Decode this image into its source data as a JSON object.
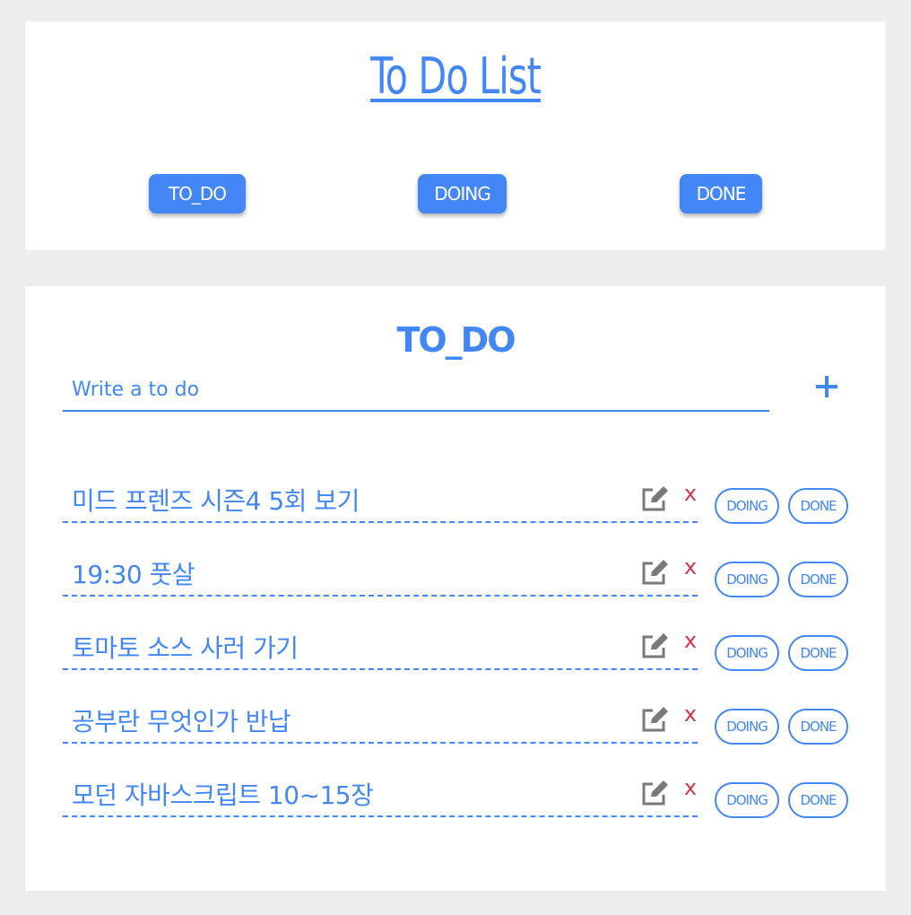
{
  "header": {
    "title": "To Do List",
    "nav": [
      {
        "label": "TO_DO"
      },
      {
        "label": "DOING"
      },
      {
        "label": "DONE"
      }
    ]
  },
  "main": {
    "section_title": "TO_DO",
    "input": {
      "placeholder": "Write a to do",
      "value": ""
    },
    "add_icon": "plus-icon",
    "items": [
      {
        "text": "미드 프렌즈 시즌4 5회 보기",
        "delete_label": "x",
        "doing_label": "DOING",
        "done_label": "DONE"
      },
      {
        "text": "19:30 풋살",
        "delete_label": "x",
        "doing_label": "DOING",
        "done_label": "DONE"
      },
      {
        "text": "토마토 소스 사러 가기",
        "delete_label": "x",
        "doing_label": "DOING",
        "done_label": "DONE"
      },
      {
        "text": "공부란 무엇인가 반납",
        "delete_label": "x",
        "doing_label": "DOING",
        "done_label": "DONE"
      },
      {
        "text": "모던 자바스크립트 10~15장",
        "delete_label": "x",
        "doing_label": "DOING",
        "done_label": "DONE"
      }
    ]
  },
  "colors": {
    "accent": "#4287f5",
    "delete": "#d7344b",
    "icon_gray": "#7a7a7a",
    "background": "#ededed",
    "card": "#ffffff"
  }
}
